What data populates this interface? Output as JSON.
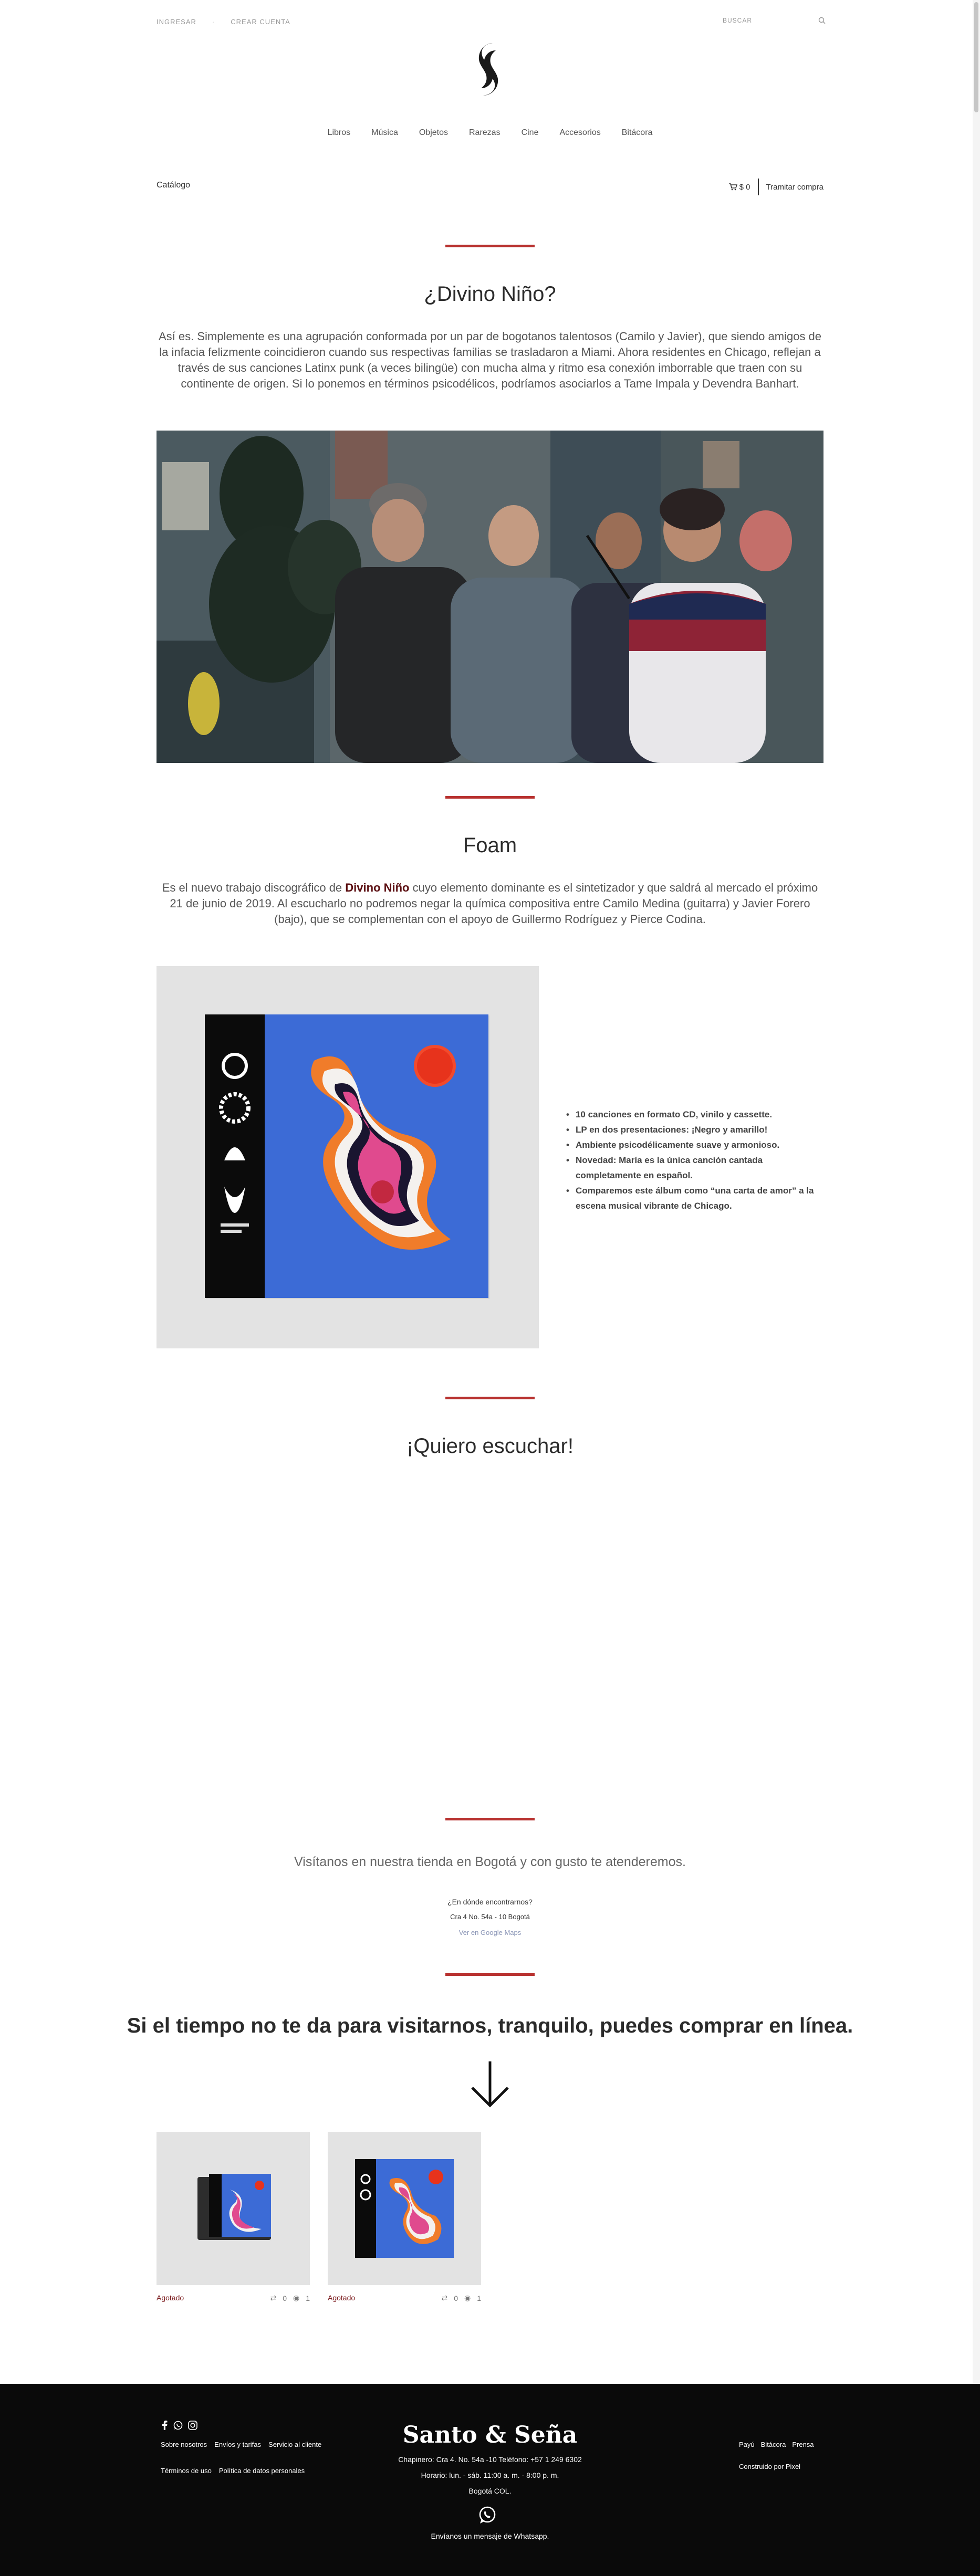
{
  "topbar": {
    "login": "INGRESAR",
    "create_account": "CREAR CUENTA",
    "search_label": "BUSCAR"
  },
  "nav": [
    "Libros",
    "Música",
    "Objetos",
    "Rarezas",
    "Cine",
    "Accesorios",
    "Bitácora"
  ],
  "subbar": {
    "catalog": "Catálogo",
    "cart_amount": "$ 0",
    "checkout": "Tramitar compra"
  },
  "section1": {
    "title": "¿Divino Niño?",
    "text": "Así es. Simplemente es una agrupación conformada por un par de bogotanos talentosos (Camilo y Javier), que siendo amigos de la infacia felizmente coincidieron cuando sus respectivas familias se trasladaron a Miami. Ahora residentes en Chicago, reflejan a través de sus canciones Latinx punk (a veces bilingüe) con mucha alma y ritmo esa conexión imborrable que traen con su continente de origen. Si lo ponemos en términos psicodélicos, podríamos asociarlos a Tame Impala y Devendra Banhart."
  },
  "section2": {
    "title": "Foam",
    "text_before": "Es el nuevo trabajo discográfico de ",
    "highlight": "Divino Niño",
    "text_after": " cuyo elemento dominante es el sintetizador y que saldrá al mercado el próximo 21 de junio de 2019. Al escucharlo no podremos negar la química compositiva entre Camilo Medina (guitarra) y Javier Forero (bajo), que se complementan con el apoyo de Guillermo Rodríguez y Pierce Codina.",
    "features": [
      "10 canciones en formato CD, vinilo y cassette.",
      "LP en dos presentaciones: ¡Negro y amarillo!",
      "Ambiente psicodélicamente suave y armonioso.",
      "Novedad: María es la única canción cantada completamente en español.",
      "Comparemos este álbum como “una carta de amor” a la escena musical vibrante de Chicago."
    ]
  },
  "section3": {
    "title": "¡Quiero escuchar!"
  },
  "section4": {
    "visit": "Visítanos en nuestra tienda en Bogotá y con gusto te atenderemos.",
    "where_q": "¿En dónde encontrarnos?",
    "address": "Cra 4 No. 54a - 10 Bogotá",
    "maps": "Ver en Google Maps"
  },
  "section5": {
    "title": "Si el tiempo no te da para visitarnos, tranquilo, puedes comprar en línea."
  },
  "products": [
    {
      "status": "Agotado",
      "reposts": "0",
      "views": "1"
    },
    {
      "status": "Agotado",
      "reposts": "0",
      "views": "1"
    }
  ],
  "footer": {
    "links_row1": [
      "Sobre nosotros",
      "Envíos y tarifas",
      "Servicio al cliente"
    ],
    "links_row2": [
      "Términos de uso",
      "Política de datos personales"
    ],
    "brand": "Santo & Seña",
    "line1": "Chapinero: Cra 4. No. 54a -10  Teléfono: +57 1 249 6302",
    "line2": "Horario: lun. - sáb. 11:00 a. m. - 8:00 p. m.",
    "line3": "Bogotá COL.",
    "whatsapp": "Envíanos un mensaje de Whatsapp.",
    "right_links": [
      "Payú",
      "Bitácora",
      "Prensa"
    ],
    "built_by": "Construido por Pixel"
  },
  "colors": {
    "accent": "#b8312f",
    "footer_bg": "#0a0a0a",
    "highlight": "#5a0d10"
  }
}
